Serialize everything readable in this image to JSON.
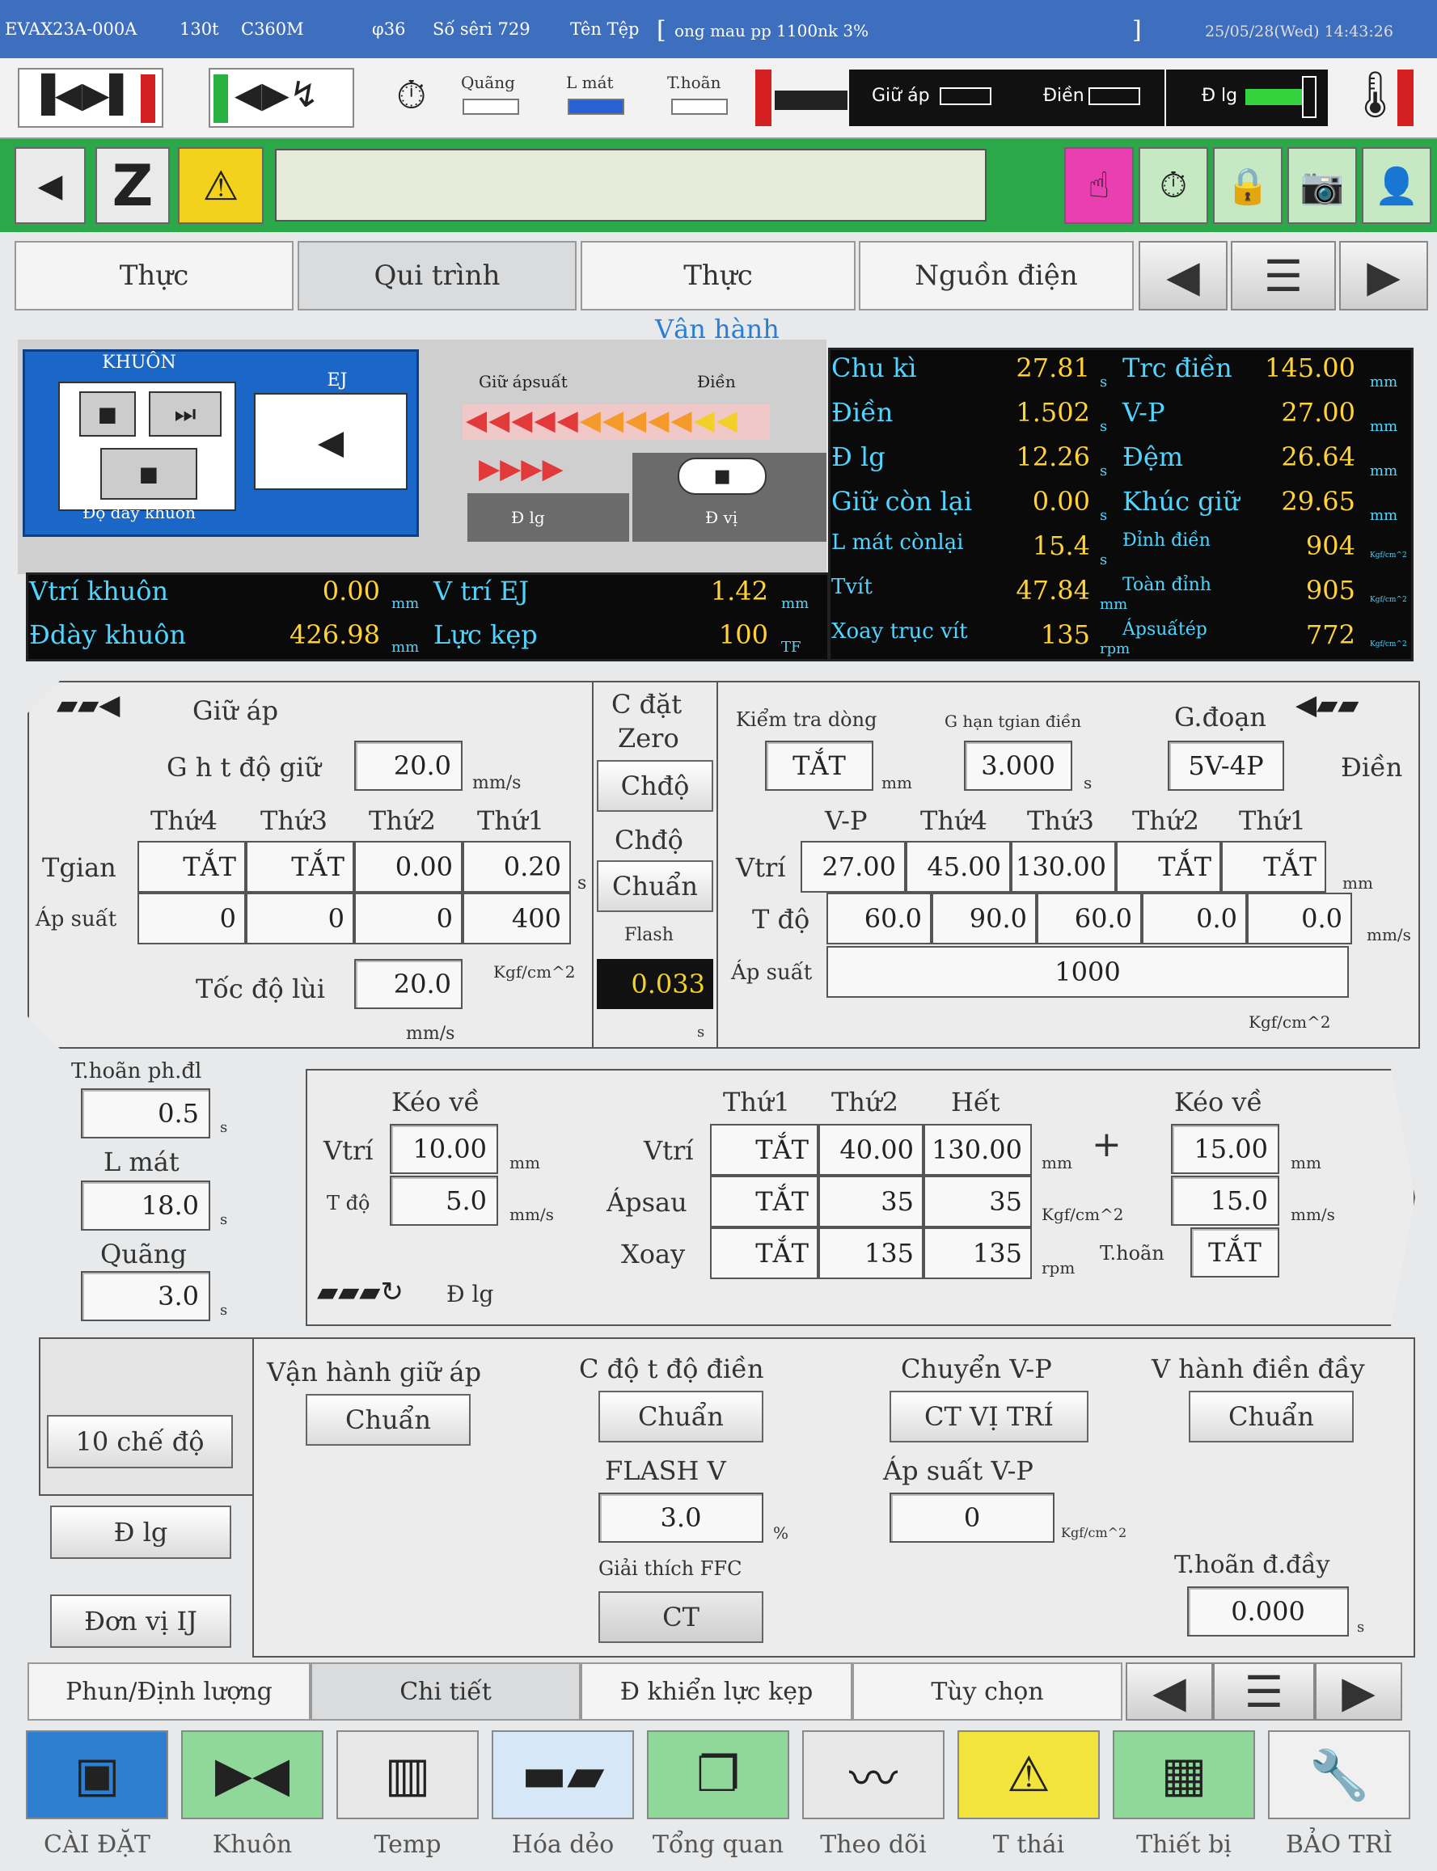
{
  "titlebar": {
    "model": "EVAX23A-000A",
    "tonnage": "130t",
    "controller": "C360M",
    "screw": "φ36",
    "serial": "Số sêri 729",
    "file_label": "Tên Tệp",
    "file_name": "ong mau pp 1100nk 3%",
    "datetime": "25/05/28(Wed) 14:43:26"
  },
  "status_icons": {
    "quang": "Quãng",
    "lmat": "L mát",
    "thoan": "T.hoãn",
    "giu_ap": "Giữ áp",
    "dien": "Điền",
    "dlg": "Đ lg"
  },
  "toolbar": {
    "back_icon": "◀",
    "z_label": "Z",
    "warning_icon": "⚠"
  },
  "tabs_top": [
    "Thực",
    "Qui trình",
    "Thực",
    "Nguồn điện"
  ],
  "section_title": "Vận hành",
  "machine": {
    "mold_label": "KHUÔN",
    "ej_label": "EJ",
    "mold_thickness_label": "Độ dày khuôn",
    "hold_label": "Giữ ápsuất",
    "fill_label": "Điền",
    "dlg_label": "Đ lg",
    "dvi_label": "Đ vị"
  },
  "monitor": [
    {
      "l1": "Chu kì",
      "v1": "27.81",
      "u1": "s",
      "l2": "Trc điền",
      "v2": "145.00",
      "u2": "mm"
    },
    {
      "l1": "Điền",
      "v1": "1.502",
      "u1": "s",
      "l2": "V-P",
      "v2": "27.00",
      "u2": "mm"
    },
    {
      "l1": "Đ lg",
      "v1": "12.26",
      "u1": "s",
      "l2": "Đệm",
      "v2": "26.64",
      "u2": "mm"
    },
    {
      "l1": "Giữ còn lại",
      "v1": "0.00",
      "u1": "s",
      "l2": "Khúc giữ",
      "v2": "29.65",
      "u2": "mm"
    },
    {
      "l1": "L mát cònlại",
      "v1": "15.4",
      "u1": "s",
      "l2": "Đỉnh điền",
      "v2": "904",
      "u2": "Kgf/cm^2"
    },
    {
      "l1": "Tvít",
      "v1": "47.84",
      "u1": "mm",
      "l2": "Toàn đỉnh",
      "v2": "905",
      "u2": "Kgf/cm^2"
    },
    {
      "l1": "Xoay trục vít",
      "v1": "135",
      "u1": "rpm",
      "l2": "Ápsuấtép",
      "v2": "772",
      "u2": "Kgf/cm^2"
    }
  ],
  "mold_monitor": {
    "vtri_khuon": "Vtrí khuôn",
    "vtri_khuon_val": "0.00",
    "vtri_khuon_unit": "mm",
    "vtri_ej": "V trí EJ",
    "vtri_ej_val": "1.42",
    "vtri_ej_unit": "mm",
    "dday_khuon": "Đdày khuôn",
    "dday_khuon_val": "426.98",
    "dday_khuon_unit": "mm",
    "luc_kep": "Lực kẹp",
    "luc_kep_val": "100",
    "luc_kep_unit": "TF"
  },
  "hold": {
    "title": "Giữ áp",
    "speed_label": "G h t độ giữ",
    "speed_val": "20.0",
    "speed_unit": "mm/s",
    "cols": [
      "Thứ4",
      "Thứ3",
      "Thứ2",
      "Thứ1"
    ],
    "tgian_label": "Tgian",
    "tgian": [
      "TẮT",
      "TẮT",
      "0.00",
      "0.20"
    ],
    "tgian_unit": "s",
    "apsuat_label": "Áp suất",
    "apsuat": [
      "0",
      "0",
      "0",
      "400"
    ],
    "apsuat_unit": "Kgf/cm^2",
    "tocdo_lui_label": "Tốc độ lùi",
    "tocdo_lui_val": "20.0",
    "tocdo_lui_unit": "mm/s"
  },
  "zero": {
    "title1": "C đặt",
    "title2": "Zero",
    "btn1": "Chđộ",
    "chdo_label": "Chđộ",
    "btn2": "Chuẩn",
    "flash_label": "Flash",
    "flash_val": "0.033",
    "flash_unit": "s"
  },
  "fill": {
    "check_label": "Kiểm tra dòng",
    "check_val": "TẮT",
    "check_unit": "mm",
    "limit_label": "G hạn tgian điền",
    "limit_val": "3.000",
    "limit_unit": "s",
    "stage_label": "G.đoạn",
    "stage_val": "5V-4P",
    "fill_label": "Điền",
    "cols": [
      "V-P",
      "Thứ4",
      "Thứ3",
      "Thứ2",
      "Thứ1"
    ],
    "vtri_label": "Vtrí",
    "vtri": [
      "27.00",
      "45.00",
      "130.00",
      "TẮT",
      "TẮT"
    ],
    "vtri_unit": "mm",
    "tdo_label": "T độ",
    "tdo": [
      "60.0",
      "90.0",
      "60.0",
      "0.0",
      "0.0"
    ],
    "tdo_unit": "mm/s",
    "apsuat_label": "Áp suất",
    "apsuat_val": "1000",
    "apsuat_unit": "Kgf/cm^2"
  },
  "timers": {
    "thoan_label": "T.hoãn ph.đl",
    "thoan_val": "0.5",
    "thoan_unit": "s",
    "lmat_label": "L mát",
    "lmat_val": "18.0",
    "lmat_unit": "s",
    "quang_label": "Quãng",
    "quang_val": "3.0",
    "quang_unit": "s"
  },
  "metering": {
    "keove1_title": "Kéo về",
    "vtri_label": "Vtrí",
    "vtri_val": "10.00",
    "vtri_unit": "mm",
    "tdo_label": "T độ",
    "tdo_val": "5.0",
    "tdo_unit": "mm/s",
    "cols": [
      "Thứ1",
      "Thứ2",
      "Hết"
    ],
    "row_vtri_label": "Vtrí",
    "row_vtri": [
      "TẮT",
      "40.00",
      "130.00"
    ],
    "row_vtri_unit": "mm",
    "row_apsau_label": "Ápsau",
    "row_apsau": [
      "TẮT",
      "35",
      "35"
    ],
    "row_apsau_unit": "Kgf/cm^2",
    "row_xoay_label": "Xoay",
    "row_xoay": [
      "TẮT",
      "135",
      "135"
    ],
    "row_xoay_unit": "rpm",
    "plus": "+",
    "keove2_title": "Kéo về",
    "keove2_vtri": "15.00",
    "keove2_vtri_unit": "mm",
    "keove2_tdo": "15.0",
    "keove2_tdo_unit": "mm/s",
    "thoan_label": "T.hoãn",
    "thoan_val": "TẮT",
    "dlg_label": "Đ lg"
  },
  "modes": {
    "btn_10mode": "10 chế độ",
    "btn_dlg": "Đ lg",
    "btn_donvi": "Đơn vị IJ",
    "vh_giu_ap_label": "Vận hành giữ áp",
    "vh_giu_ap_val": "Chuẩn",
    "c_do_label": "C độ t độ điền",
    "c_do_val": "Chuẩn",
    "chuyen_vp_label": "Chuyển V-P",
    "chuyen_vp_val": "CT VỊ TRÍ",
    "vh_dien_day_label": "V hành điền đầy",
    "vh_dien_day_val": "Chuẩn",
    "flash_v_label": "FLASH V",
    "flash_v_val": "3.0",
    "flash_v_unit": "%",
    "ap_vp_label": "Áp suất V-P",
    "ap_vp_val": "0",
    "ap_vp_unit": "Kgf/cm^2",
    "ffc_label": "Giải thích FFC",
    "ffc_val": "CT",
    "thoan_day_label": "T.hoãn đ.đầy",
    "thoan_day_val": "0.000",
    "thoan_day_unit": "s"
  },
  "tabs_bottom": [
    "Phun/Định lượng",
    "Chi tiết",
    "Đ khiển lực kẹp",
    "Tùy chọn"
  ],
  "bottom_nav": [
    {
      "icon": "settings-icon",
      "label": "CÀI ĐẶT",
      "color": "#2f7fd0"
    },
    {
      "icon": "mold-icon",
      "label": "Khuôn",
      "color": "#8fd89a"
    },
    {
      "icon": "heater-icon",
      "label": "Temp",
      "color": "#e8e8e8"
    },
    {
      "icon": "injection-icon",
      "label": "Hóa dẻo",
      "color": "#d6e8f7"
    },
    {
      "icon": "overview-icon",
      "label": "Tổng quan",
      "color": "#8fd89a"
    },
    {
      "icon": "chart-icon",
      "label": "Theo dõi",
      "color": "#e8e8e8"
    },
    {
      "icon": "warning-icon",
      "label": "T thái",
      "color": "#f2e43c"
    },
    {
      "icon": "machine-icon",
      "label": "Thiết bị",
      "color": "#8fd89a"
    },
    {
      "icon": "wrench-icon",
      "label": "BẢO TRÌ",
      "color": "#f0f0f0"
    }
  ]
}
